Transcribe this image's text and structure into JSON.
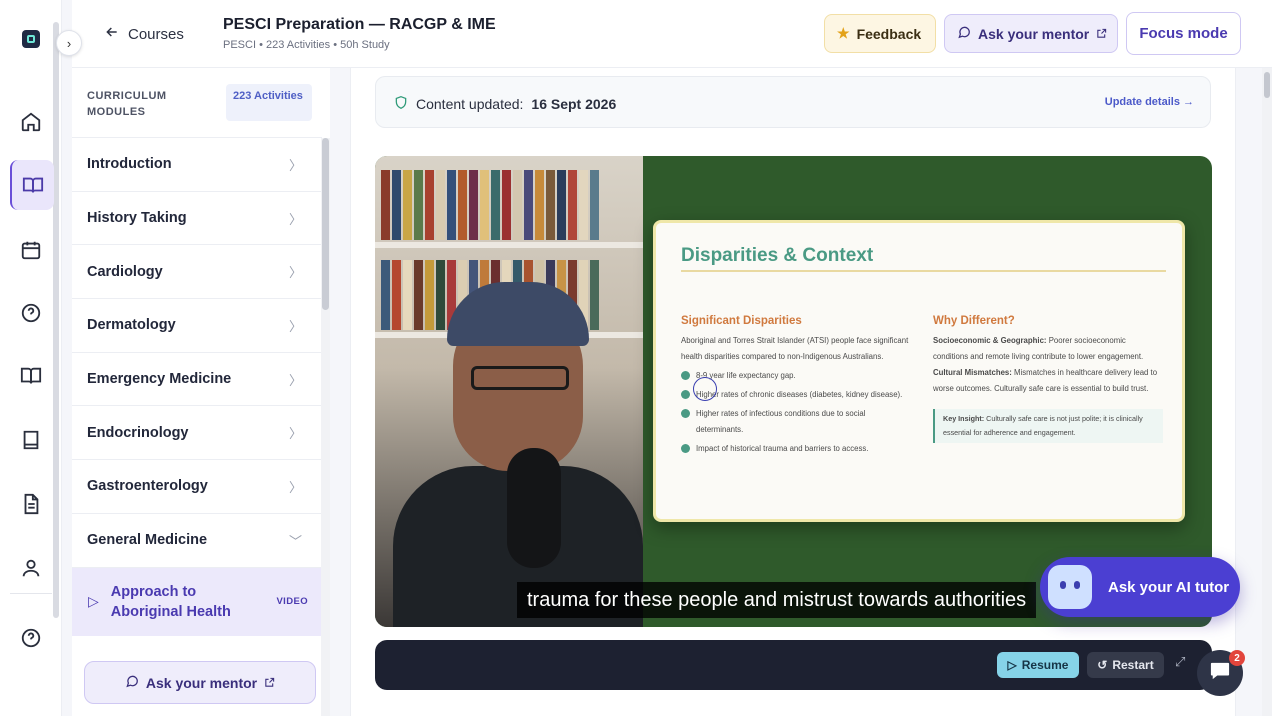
{
  "header": {
    "back_label": "Courses",
    "course_title": "PESCI Preparation — RACGP & IME",
    "course_meta": "PESCI • 223 Activities • 50h Study",
    "feedback_label": "Feedback",
    "mentor_label": "Ask your mentor",
    "focus_label": "Focus mode"
  },
  "rail": {
    "icons": [
      "home-icon",
      "book-open-icon",
      "calendar-icon",
      "help-icon",
      "library-icon",
      "notebook-icon",
      "document-icon",
      "user-icon",
      "help-icon"
    ],
    "active_index": 1
  },
  "curriculum": {
    "label": "CURRICULUM MODULES",
    "count": "223 Activities",
    "modules": [
      {
        "label": "Introduction",
        "expanded": false
      },
      {
        "label": "History Taking",
        "expanded": false
      },
      {
        "label": "Cardiology",
        "expanded": false
      },
      {
        "label": "Dermatology",
        "expanded": false
      },
      {
        "label": "Emergency Medicine",
        "expanded": false
      },
      {
        "label": "Endocrinology",
        "expanded": false
      },
      {
        "label": "Gastroenterology",
        "expanded": false
      },
      {
        "label": "General Medicine",
        "expanded": true
      }
    ],
    "active_lesson": {
      "title": "Approach to Aboriginal Health",
      "type": "VIDEO"
    },
    "mentor_label": "Ask your mentor"
  },
  "content_updated": {
    "prefix": "Content updated:",
    "date": "16 Sept 2026",
    "link": "Update details →"
  },
  "slide": {
    "title": "Disparities & Context",
    "left_heading": "Significant Disparities",
    "left_intro": "Aboriginal and Torres Strait Islander (ATSI) people face significant health disparities compared to non-Indigenous Australians.",
    "bullets": [
      "8-9 year life expectancy gap.",
      "Higher rates of chronic diseases (diabetes, kidney disease).",
      "Higher rates of infectious conditions due to social determinants.",
      "Impact of historical trauma and barriers to access."
    ],
    "right_heading": "Why Different?",
    "right_p1_bold": "Socioeconomic & Geographic:",
    "right_p1": "Poorer socioeconomic conditions and remote living contribute to lower engagement.",
    "right_p2_bold": "Cultural Mismatches:",
    "right_p2": "Mismatches in healthcare delivery lead to worse outcomes. Culturally safe care is essential to build trust.",
    "insight_bold": "Key Insight:",
    "insight": "Culturally safe care is not just polite; it is clinically essential for adherence and engagement."
  },
  "video": {
    "caption": "trauma for these people and mistrust towards authorities"
  },
  "controls": {
    "resume_label": "Resume",
    "restart_label": "Restart"
  },
  "ai_tutor": {
    "label": "Ask your AI tutor"
  },
  "chat": {
    "badge": "2"
  },
  "colors": {
    "accent": "#4b3fd2",
    "slide_bg": "#2f5a2b",
    "slide_title": "#4a9a84"
  }
}
